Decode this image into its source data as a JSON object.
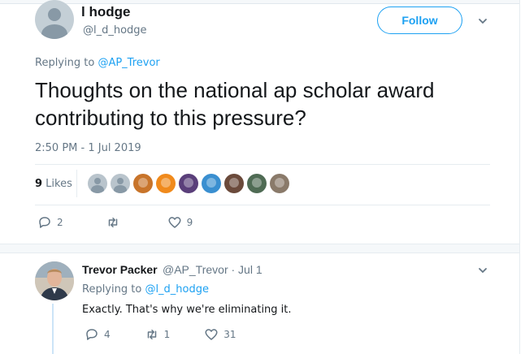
{
  "tweet": {
    "author_name": "l hodge",
    "author_handle": "@l_d_hodge",
    "follow_label": "Follow",
    "replying_prefix": "Replying to ",
    "replying_handle": "@AP_Trevor",
    "text": "Thoughts on the national ap scholar award contributing to this pressure?",
    "timestamp": "2:50 PM - 1 Jul 2019",
    "likes_count": "9",
    "likes_label": " Likes",
    "stats": {
      "replies": "2",
      "retweets": "",
      "likes": "9"
    }
  },
  "liker_avatar_colors": [
    "#b9c4cc",
    "#b9c4cc",
    "#c8742a",
    "#f08a1c",
    "#5a3f7a",
    "#3a8fd0",
    "#6b4a3b",
    "#4f6b54",
    "#8a7a6a"
  ],
  "reply": {
    "author_name": "Trevor Packer",
    "author_meta": "@AP_Trevor · Jul 1",
    "replying_prefix": "Replying to ",
    "replying_handle": "@l_d_hodge",
    "text": "Exactly. That's why we're eliminating it.",
    "stats": {
      "replies": "4",
      "retweets": "1",
      "likes": "31"
    }
  },
  "colors": {
    "accent": "#1da1f2",
    "muted": "#657786",
    "text": "#14171a"
  }
}
